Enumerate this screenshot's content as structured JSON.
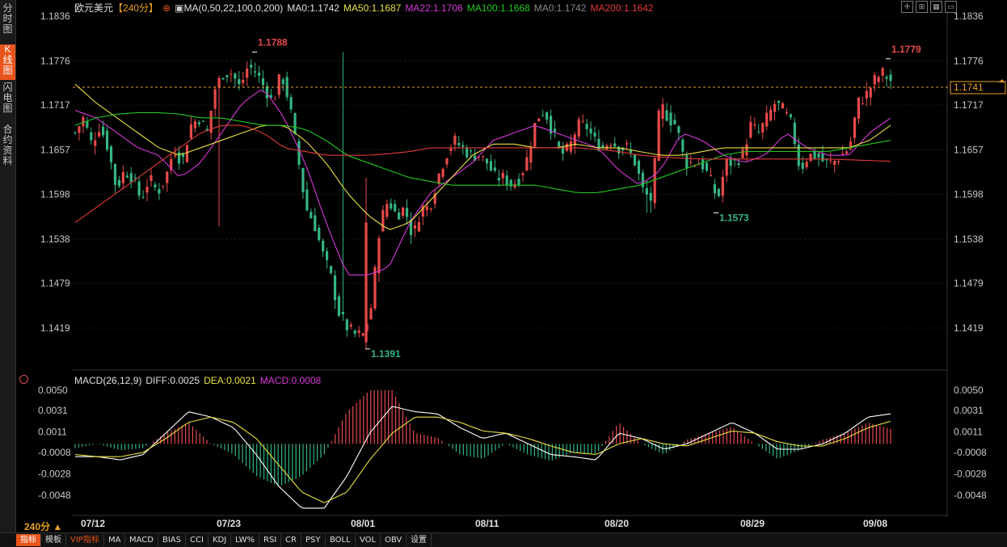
{
  "side_tabs": [
    {
      "label": "分时图",
      "active": false
    },
    {
      "label": "K线图",
      "active": true
    },
    {
      "label": "闪电图",
      "active": false
    },
    {
      "label": "合约资料",
      "active": false
    }
  ],
  "legend": {
    "symbol": "欧元美元",
    "period": "【240分】",
    "ma_title": "MA(0,50,22,100,0,200)",
    "ma0": "MA0:1.1742",
    "ma50": "MA50:1.1687",
    "ma22": "MA22:1.1706",
    "ma100": "MA100:1.1668",
    "ma0b": "MA0:1.1742",
    "ma200": "MA200:1.1642"
  },
  "macd_legend": {
    "title": "MACD(26,12,9)",
    "diff": "DIFF:0.0025",
    "dea": "DEA:0.0021",
    "macd": "MACD:0.0008"
  },
  "current_price": "1.1741",
  "period_label": "240分 ▲",
  "bottom_tabs": [
    "指标",
    "模板",
    "VIP指标",
    "MA",
    "MACD",
    "BIAS",
    "CCI",
    "KDJ",
    "LW%",
    "RSI",
    "CR",
    "PSY",
    "BOLL",
    "VOL",
    "OBV",
    "设置"
  ],
  "colors": {
    "up": "#e84a4a",
    "down": "#34b582",
    "ma22": "#d838d8",
    "ma50": "#e8e040",
    "ma100": "#20c820",
    "ma200": "#e03a3a",
    "diff": "#ffffff",
    "dea": "#e8e040",
    "bg": "#000000",
    "grid": "#2a2a2a"
  },
  "chart_data": [
    {
      "type": "candlestick",
      "price_axis_ticks": [
        "1.1836",
        "1.1776",
        "1.1717",
        "1.1657",
        "1.1598",
        "1.1538",
        "1.1479",
        "1.1419"
      ],
      "ylim": [
        1.138,
        1.184
      ],
      "x_labels": [
        "07/12",
        "07/23",
        "08/01",
        "08/11",
        "08/20",
        "08/29",
        "09/08"
      ],
      "annotations": [
        {
          "label": "1.1788",
          "value": 1.1788,
          "kind": "high"
        },
        {
          "label": "1.1391",
          "value": 1.1391,
          "kind": "low"
        },
        {
          "label": "1.1573",
          "value": 1.1573,
          "kind": "low"
        },
        {
          "label": "1.1779",
          "value": 1.1779,
          "kind": "high"
        }
      ],
      "anchors": [
        1.168,
        1.17,
        1.1665,
        1.169,
        1.166,
        1.1605,
        1.163,
        1.162,
        1.159,
        1.162,
        1.16,
        1.162,
        1.166,
        1.164,
        1.169,
        1.17,
        1.168,
        1.174,
        1.176,
        1.176,
        1.174,
        1.177,
        1.176,
        1.174,
        1.172,
        1.176,
        1.172,
        1.165,
        1.158,
        1.156,
        1.152,
        1.149,
        1.144,
        1.142,
        1.141,
        1.141,
        1.145,
        1.156,
        1.159,
        1.157,
        1.158,
        1.154,
        1.158,
        1.158,
        1.162,
        1.165,
        1.167,
        1.166,
        1.165,
        1.165,
        1.164,
        1.162,
        1.162,
        1.161,
        1.162,
        1.165,
        1.17,
        1.171,
        1.168,
        1.165,
        1.166,
        1.169,
        1.169,
        1.167,
        1.166,
        1.167,
        1.166,
        1.166,
        1.164,
        1.16,
        1.159,
        1.172,
        1.17,
        1.169,
        1.164,
        1.164,
        1.164,
        1.162,
        1.159,
        1.164,
        1.164,
        1.165,
        1.169,
        1.168,
        1.17,
        1.172,
        1.171,
        1.169,
        1.163,
        1.165,
        1.165,
        1.164,
        1.164,
        1.165,
        1.166,
        1.172,
        1.173,
        1.175,
        1.176,
        1.175
      ],
      "ma_lines": [
        {
          "name": "MA22",
          "color": "#d838d8",
          "anchors": [
            1.171,
            1.17,
            1.168,
            1.166,
            1.165,
            1.162,
            1.164,
            1.168,
            1.172,
            1.174,
            1.17,
            1.164,
            1.156,
            1.149,
            1.149,
            1.15,
            1.156,
            1.16,
            1.162,
            1.164,
            1.167,
            1.168,
            1.169,
            1.168,
            1.167,
            1.166,
            1.163,
            1.161,
            1.163,
            1.168,
            1.167,
            1.165,
            1.164,
            1.165,
            1.168,
            1.166,
            1.165,
            1.165,
            1.168,
            1.17
          ]
        },
        {
          "name": "MA50",
          "color": "#e8e040",
          "anchors": [
            1.1745,
            1.172,
            1.17,
            1.168,
            1.166,
            1.165,
            1.166,
            1.167,
            1.168,
            1.169,
            1.169,
            1.167,
            1.164,
            1.16,
            1.157,
            1.155,
            1.156,
            1.159,
            1.162,
            1.165,
            1.1665,
            1.1665,
            1.166,
            1.166,
            1.1665,
            1.166,
            1.166,
            1.1655,
            1.165,
            1.165,
            1.1655,
            1.166,
            1.166,
            1.166,
            1.166,
            1.166,
            1.166,
            1.166,
            1.167,
            1.169
          ]
        },
        {
          "name": "MA100",
          "color": "#20c820",
          "anchors": [
            1.169,
            1.17,
            1.1705,
            1.1707,
            1.1707,
            1.1705,
            1.17,
            1.17,
            1.1695,
            1.169,
            1.169,
            1.1685,
            1.167,
            1.165,
            1.164,
            1.163,
            1.162,
            1.1615,
            1.161,
            1.161,
            1.161,
            1.161,
            1.161,
            1.1605,
            1.16,
            1.16,
            1.1605,
            1.161,
            1.162,
            1.163,
            1.164,
            1.165,
            1.1655,
            1.1655,
            1.1655,
            1.1655,
            1.1655,
            1.166,
            1.1665,
            1.167
          ]
        },
        {
          "name": "MA200",
          "color": "#e03a3a",
          "anchors": [
            1.156,
            1.158,
            1.16,
            1.162,
            1.164,
            1.166,
            1.168,
            1.169,
            1.169,
            1.168,
            1.166,
            1.1655,
            1.165,
            1.165,
            1.165,
            1.1652,
            1.1655,
            1.166,
            1.166,
            1.166,
            1.166,
            1.166,
            1.166,
            1.166,
            1.166,
            1.1658,
            1.1655,
            1.165,
            1.1648,
            1.1646,
            1.1645,
            1.1645,
            1.1645,
            1.1645,
            1.1645,
            1.1645,
            1.1645,
            1.1644,
            1.1643,
            1.1642
          ]
        }
      ]
    },
    {
      "type": "macd",
      "axis_ticks": [
        "0.0050",
        "0.0031",
        "0.0011",
        "-0.0008",
        "-0.0028",
        "-0.0048"
      ],
      "ylim": [
        -0.0058,
        0.0055
      ],
      "diff_anchors": [
        -0.0012,
        -0.0012,
        -0.0015,
        -0.001,
        0.001,
        0.003,
        0.0025,
        0.0015,
        -0.001,
        -0.004,
        -0.006,
        -0.006,
        -0.003,
        0.001,
        0.0035,
        0.003,
        0.0028,
        0.0015,
        0.0005,
        0.001,
        0.0,
        -0.001,
        -0.0012,
        -0.0015,
        0.001,
        0.0005,
        -0.0005,
        0.0,
        0.001,
        0.002,
        0.001,
        -0.0005,
        -0.0005,
        0.0,
        0.001,
        0.0025,
        0.0028
      ],
      "dea_anchors": [
        -0.001,
        -0.0012,
        -0.0012,
        -0.0008,
        0.0005,
        0.002,
        0.0025,
        0.002,
        0.0005,
        -0.002,
        -0.0045,
        -0.0055,
        -0.0045,
        -0.0015,
        0.001,
        0.0025,
        0.0025,
        0.002,
        0.0012,
        0.001,
        0.0005,
        -0.0002,
        -0.0008,
        -0.001,
        0.0,
        0.0005,
        0.0,
        -0.0002,
        0.0005,
        0.0012,
        0.001,
        0.0002,
        -0.0002,
        -0.0002,
        0.0005,
        0.0015,
        0.0021
      ]
    }
  ]
}
